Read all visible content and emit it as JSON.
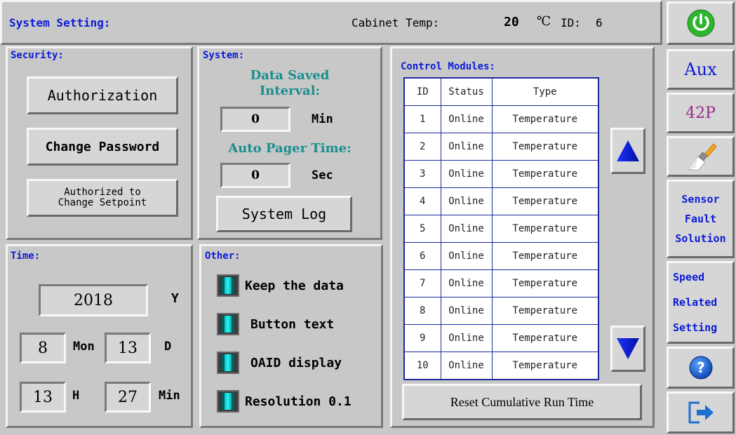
{
  "header": {
    "title": "System Setting:",
    "cabinet_label": "Cabinet Temp:",
    "cabinet_value": "20",
    "cabinet_unit": "℃",
    "id_label": "ID:",
    "id_value": "6"
  },
  "security": {
    "title": "Security:",
    "authorization": "Authorization",
    "change_password": "Change Password",
    "setpoint_line1": "Authorized to",
    "setpoint_line2": "Change Setpoint"
  },
  "system": {
    "title": "System:",
    "data_saved_line1": "Data Saved",
    "data_saved_line2": "Interval:",
    "data_saved_value": "0",
    "data_saved_unit": "Min",
    "auto_pager_label": "Auto Pager Time:",
    "auto_pager_value": "0",
    "auto_pager_unit": "Sec",
    "system_log": "System Log"
  },
  "time": {
    "title": "Time:",
    "year": "2018",
    "year_unit": "Y",
    "month": "8",
    "month_unit": "Mon",
    "day": "13",
    "day_unit": "D",
    "hour": "13",
    "hour_unit": "H",
    "minute": "27",
    "minute_unit": "Min"
  },
  "other": {
    "title": "Other:",
    "options": [
      "Keep the data",
      "Button text",
      "OAID display",
      "Resolution 0.1"
    ]
  },
  "modules": {
    "title": "Control Modules:",
    "headers": [
      "ID",
      "Status",
      "Type"
    ],
    "rows": [
      [
        "1",
        "Online",
        "Temperature"
      ],
      [
        "2",
        "Online",
        "Temperature"
      ],
      [
        "3",
        "Online",
        "Temperature"
      ],
      [
        "4",
        "Online",
        "Temperature"
      ],
      [
        "5",
        "Online",
        "Temperature"
      ],
      [
        "6",
        "Online",
        "Temperature"
      ],
      [
        "7",
        "Online",
        "Temperature"
      ],
      [
        "8",
        "Online",
        "Temperature"
      ],
      [
        "9",
        "Online",
        "Temperature"
      ],
      [
        "10",
        "Online",
        "Temperature"
      ]
    ],
    "reset_button": "Reset Cumulative Run Time"
  },
  "sidebar": {
    "aux": "Aux",
    "p42": "42P",
    "sensor_line1": "Sensor",
    "sensor_line2": "Fault",
    "sensor_line3": "Solution",
    "speed_line1": "Speed",
    "speed_line2": "Related",
    "speed_line3": "Setting",
    "icons": [
      "power-icon",
      "clean-brush-icon",
      "help-icon",
      "exit-icon"
    ]
  },
  "colors": {
    "accent_blue": "#0b1bd8",
    "teal": "#1a8e8e",
    "power_green": "#2fb52f",
    "purple": "#9c2a8c",
    "checkbox_cyan": "#19d6d6"
  }
}
